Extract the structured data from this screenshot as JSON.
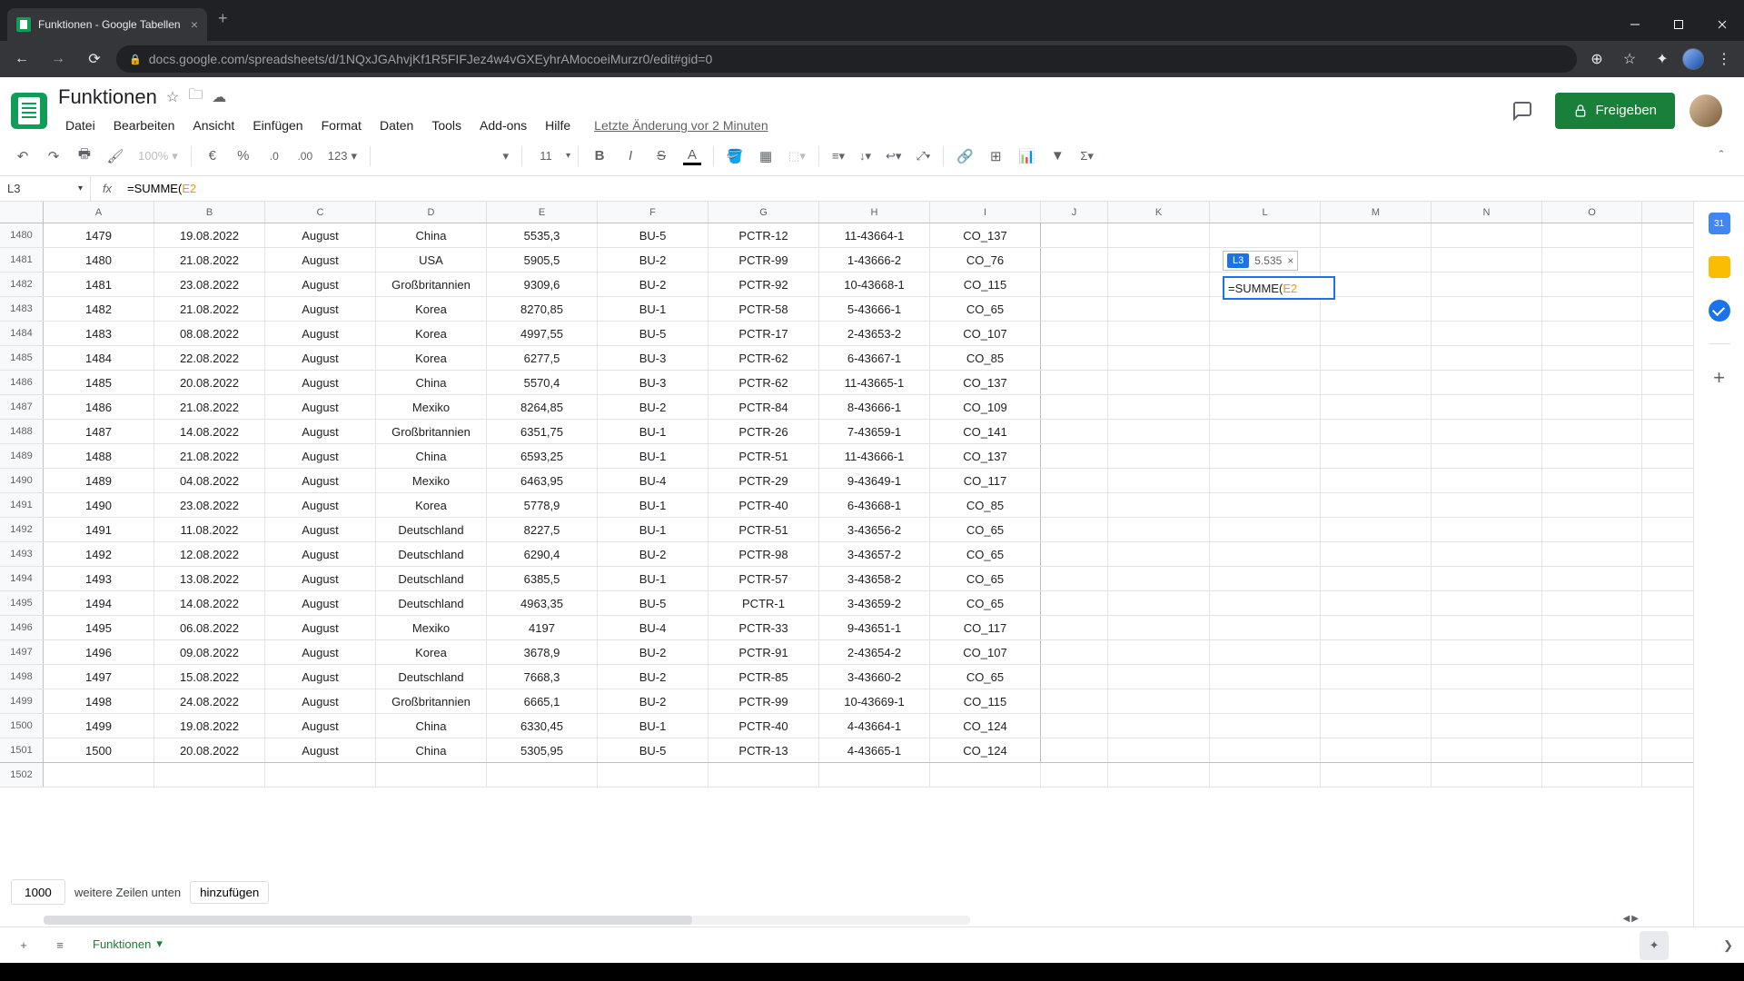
{
  "browser": {
    "tab_title": "Funktionen - Google Tabellen",
    "url": "docs.google.com/spreadsheets/d/1NQxJGAhvjKf1R5FIFJez4w4vGXEyhrAMocoeiMurzr0/edit#gid=0"
  },
  "doc": {
    "title": "Funktionen",
    "menu": [
      "Datei",
      "Bearbeiten",
      "Ansicht",
      "Einfügen",
      "Format",
      "Daten",
      "Tools",
      "Add-ons",
      "Hilfe"
    ],
    "last_edit": "Letzte Änderung vor 2 Minuten",
    "share_label": "Freigeben"
  },
  "toolbar": {
    "zoom": "100%",
    "currency": "€",
    "percent": "%",
    "dec_dec": ".0",
    "inc_dec": ".00",
    "numfmt": "123",
    "font": "",
    "font_size": "11"
  },
  "fx": {
    "cell_ref": "L3",
    "formula_prefix": "=SUMME(",
    "formula_ref": "E2"
  },
  "columns": [
    "A",
    "B",
    "C",
    "D",
    "E",
    "F",
    "G",
    "H",
    "I",
    "J",
    "K",
    "L",
    "M",
    "N",
    "O"
  ],
  "row_start": 1480,
  "rows": [
    {
      "n": 1479,
      "date": "19.08.2022",
      "mon": "August",
      "ctry": "China",
      "val": "5535,3",
      "bu": "BU-5",
      "pctr": "PCTR-12",
      "code": "11-43664-1",
      "co": "CO_137"
    },
    {
      "n": 1480,
      "date": "21.08.2022",
      "mon": "August",
      "ctry": "USA",
      "val": "5905,5",
      "bu": "BU-2",
      "pctr": "PCTR-99",
      "code": "1-43666-2",
      "co": "CO_76"
    },
    {
      "n": 1481,
      "date": "23.08.2022",
      "mon": "August",
      "ctry": "Großbritannien",
      "val": "9309,6",
      "bu": "BU-2",
      "pctr": "PCTR-92",
      "code": "10-43668-1",
      "co": "CO_115"
    },
    {
      "n": 1482,
      "date": "21.08.2022",
      "mon": "August",
      "ctry": "Korea",
      "val": "8270,85",
      "bu": "BU-1",
      "pctr": "PCTR-58",
      "code": "5-43666-1",
      "co": "CO_65"
    },
    {
      "n": 1483,
      "date": "08.08.2022",
      "mon": "August",
      "ctry": "Korea",
      "val": "4997,55",
      "bu": "BU-5",
      "pctr": "PCTR-17",
      "code": "2-43653-2",
      "co": "CO_107"
    },
    {
      "n": 1484,
      "date": "22.08.2022",
      "mon": "August",
      "ctry": "Korea",
      "val": "6277,5",
      "bu": "BU-3",
      "pctr": "PCTR-62",
      "code": "6-43667-1",
      "co": "CO_85"
    },
    {
      "n": 1485,
      "date": "20.08.2022",
      "mon": "August",
      "ctry": "China",
      "val": "5570,4",
      "bu": "BU-3",
      "pctr": "PCTR-62",
      "code": "11-43665-1",
      "co": "CO_137"
    },
    {
      "n": 1486,
      "date": "21.08.2022",
      "mon": "August",
      "ctry": "Mexiko",
      "val": "8264,85",
      "bu": "BU-2",
      "pctr": "PCTR-84",
      "code": "8-43666-1",
      "co": "CO_109"
    },
    {
      "n": 1487,
      "date": "14.08.2022",
      "mon": "August",
      "ctry": "Großbritannien",
      "val": "6351,75",
      "bu": "BU-1",
      "pctr": "PCTR-26",
      "code": "7-43659-1",
      "co": "CO_141"
    },
    {
      "n": 1488,
      "date": "21.08.2022",
      "mon": "August",
      "ctry": "China",
      "val": "6593,25",
      "bu": "BU-1",
      "pctr": "PCTR-51",
      "code": "11-43666-1",
      "co": "CO_137"
    },
    {
      "n": 1489,
      "date": "04.08.2022",
      "mon": "August",
      "ctry": "Mexiko",
      "val": "6463,95",
      "bu": "BU-4",
      "pctr": "PCTR-29",
      "code": "9-43649-1",
      "co": "CO_117"
    },
    {
      "n": 1490,
      "date": "23.08.2022",
      "mon": "August",
      "ctry": "Korea",
      "val": "5778,9",
      "bu": "BU-1",
      "pctr": "PCTR-40",
      "code": "6-43668-1",
      "co": "CO_85"
    },
    {
      "n": 1491,
      "date": "11.08.2022",
      "mon": "August",
      "ctry": "Deutschland",
      "val": "8227,5",
      "bu": "BU-1",
      "pctr": "PCTR-51",
      "code": "3-43656-2",
      "co": "CO_65"
    },
    {
      "n": 1492,
      "date": "12.08.2022",
      "mon": "August",
      "ctry": "Deutschland",
      "val": "6290,4",
      "bu": "BU-2",
      "pctr": "PCTR-98",
      "code": "3-43657-2",
      "co": "CO_65"
    },
    {
      "n": 1493,
      "date": "13.08.2022",
      "mon": "August",
      "ctry": "Deutschland",
      "val": "6385,5",
      "bu": "BU-1",
      "pctr": "PCTR-57",
      "code": "3-43658-2",
      "co": "CO_65"
    },
    {
      "n": 1494,
      "date": "14.08.2022",
      "mon": "August",
      "ctry": "Deutschland",
      "val": "4963,35",
      "bu": "BU-5",
      "pctr": "PCTR-1",
      "code": "3-43659-2",
      "co": "CO_65"
    },
    {
      "n": 1495,
      "date": "06.08.2022",
      "mon": "August",
      "ctry": "Mexiko",
      "val": "4197",
      "bu": "BU-4",
      "pctr": "PCTR-33",
      "code": "9-43651-1",
      "co": "CO_117"
    },
    {
      "n": 1496,
      "date": "09.08.2022",
      "mon": "August",
      "ctry": "Korea",
      "val": "3678,9",
      "bu": "BU-2",
      "pctr": "PCTR-91",
      "code": "2-43654-2",
      "co": "CO_107"
    },
    {
      "n": 1497,
      "date": "15.08.2022",
      "mon": "August",
      "ctry": "Deutschland",
      "val": "7668,3",
      "bu": "BU-2",
      "pctr": "PCTR-85",
      "code": "3-43660-2",
      "co": "CO_65"
    },
    {
      "n": 1498,
      "date": "24.08.2022",
      "mon": "August",
      "ctry": "Großbritannien",
      "val": "6665,1",
      "bu": "BU-2",
      "pctr": "PCTR-99",
      "code": "10-43669-1",
      "co": "CO_115"
    },
    {
      "n": 1499,
      "date": "19.08.2022",
      "mon": "August",
      "ctry": "China",
      "val": "6330,45",
      "bu": "BU-1",
      "pctr": "PCTR-40",
      "code": "4-43664-1",
      "co": "CO_124"
    },
    {
      "n": 1500,
      "date": "20.08.2022",
      "mon": "August",
      "ctry": "China",
      "val": "5305,95",
      "bu": "BU-5",
      "pctr": "PCTR-13",
      "code": "4-43665-1",
      "co": "CO_124"
    }
  ],
  "hint": {
    "ref": "L3",
    "value": "5.535"
  },
  "add_rows": {
    "count": "1000",
    "label_mid": "weitere Zeilen unten",
    "button": "hinzufügen"
  },
  "sheet_tab": "Funktionen"
}
